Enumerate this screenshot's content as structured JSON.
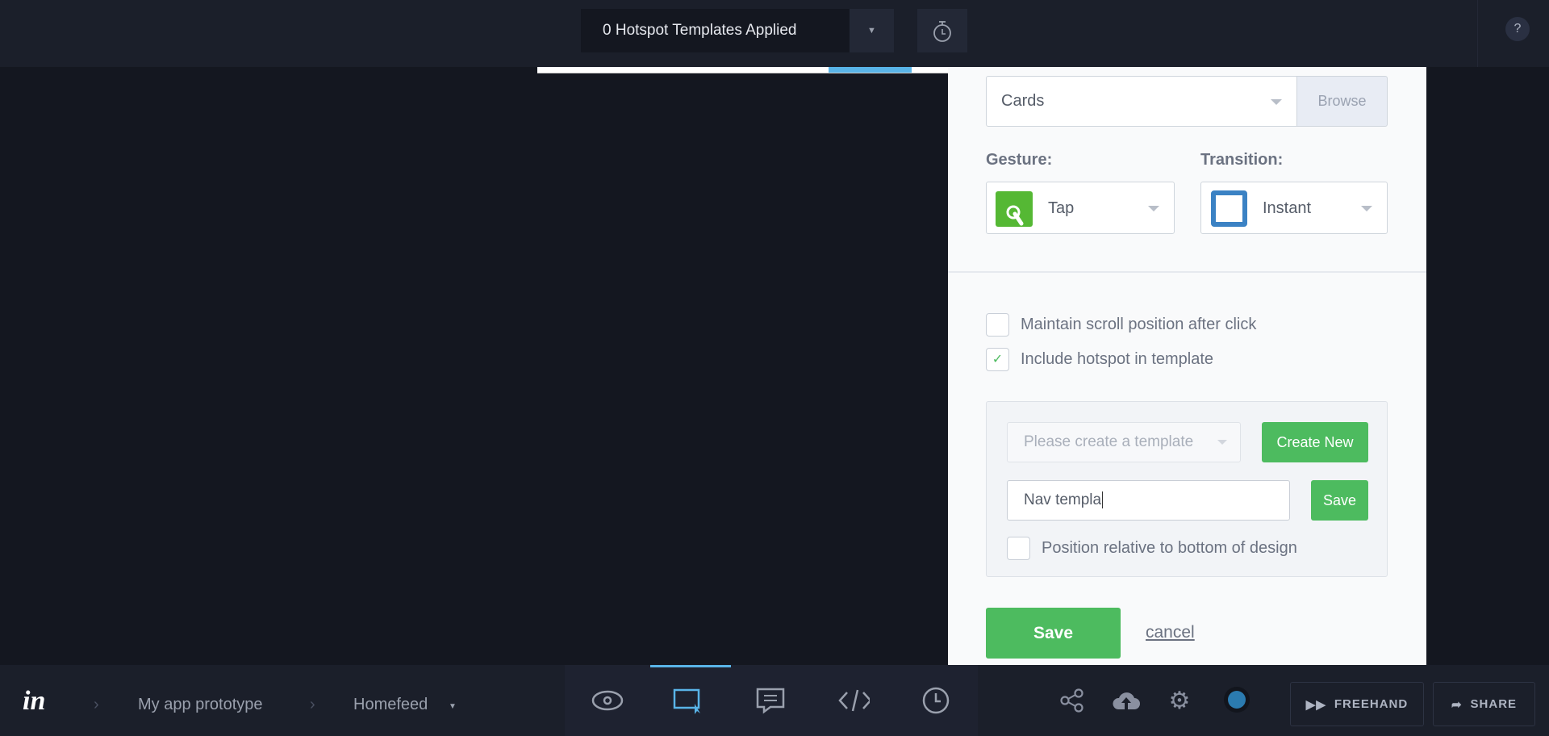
{
  "topbar": {
    "templates_applied": "0 Hotspot Templates Applied",
    "help": "?"
  },
  "panel": {
    "link_target": "Cards",
    "browse": "Browse",
    "gesture_label": "Gesture:",
    "gesture_value": "Tap",
    "transition_label": "Transition:",
    "transition_value": "Instant",
    "maintain_scroll": "Maintain scroll position after click",
    "maintain_scroll_checked": false,
    "include_template": "Include hotspot in template",
    "include_template_checked": true,
    "template_placeholder": "Please create a template",
    "create_new": "Create New",
    "template_name": "Nav templa",
    "template_save": "Save",
    "position_bottom": "Position relative to bottom of design",
    "position_bottom_checked": false,
    "save": "Save",
    "cancel": "cancel"
  },
  "colors": {
    "accent_green": "#4dbb5f",
    "accent_blue": "#3b82c4",
    "active_tab": "#59b4e8"
  },
  "bottombar": {
    "breadcrumbs": [
      "My app prototype",
      "Homefeed"
    ],
    "modes": [
      "preview",
      "build",
      "comment",
      "inspect",
      "history"
    ],
    "active_mode": "build",
    "freehand": "FREEHAND",
    "share": "SHARE"
  }
}
